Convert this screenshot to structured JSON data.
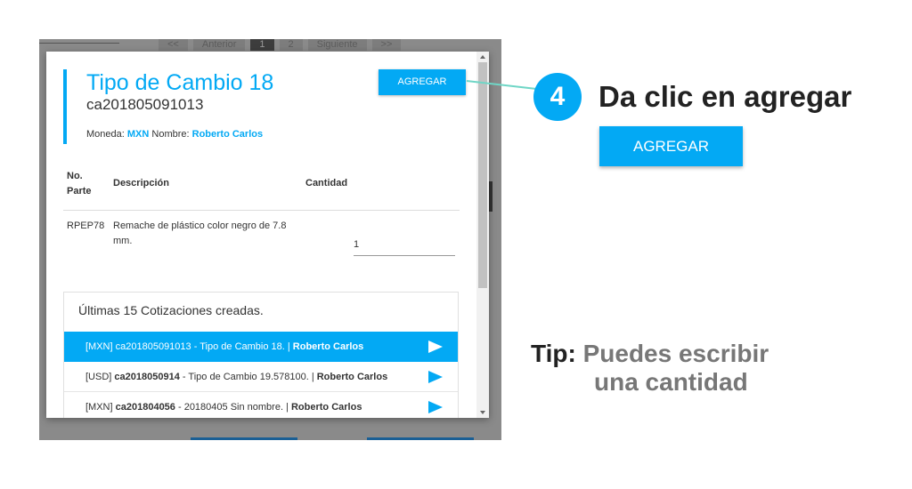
{
  "background": {
    "pager": [
      "<<",
      "Anterior",
      "1",
      "2",
      "Siguiente",
      ">>"
    ],
    "pager_active": "1"
  },
  "modal": {
    "title": "Tipo de Cambio 18",
    "code": "ca201805091013",
    "moneda_label": "Moneda:",
    "moneda_value": "MXN",
    "nombre_label": "Nombre:",
    "nombre_value": "Roberto Carlos",
    "agregar_label": "AGREGAR",
    "table": {
      "headers": {
        "no_parte": "No. Parte",
        "descripcion": "Descripción",
        "cantidad": "Cantidad"
      },
      "rows": [
        {
          "no_parte": "RPEP78",
          "descripcion": "Remache de plástico color negro de 7.8 mm.",
          "cantidad": "1"
        }
      ]
    },
    "recent": {
      "title": "Últimas 15 Cotizaciones creadas.",
      "items": [
        {
          "prefix": "[MXN] ",
          "code": "ca201805091013",
          "mid": " - Tipo de Cambio 18. | ",
          "user": "Roberto Carlos",
          "active": true
        },
        {
          "prefix": "[USD] ",
          "code": "ca2018050914",
          "mid": " - Tipo de Cambio 19.578100. | ",
          "user": "Roberto Carlos",
          "active": false
        },
        {
          "prefix": "[MXN] ",
          "code": "ca201804056",
          "mid": " - 20180405 Sin nombre. | ",
          "user": "Roberto Carlos",
          "active": false
        }
      ]
    }
  },
  "annotation": {
    "step_number": "4",
    "step_text": "Da clic en agregar",
    "button_label": "AGREGAR",
    "tip_label": "Tip:",
    "tip_line1": "Puedes escribir",
    "tip_line2": "una cantidad"
  },
  "colors": {
    "accent": "#03a9f4",
    "connector": "#6fd6c6",
    "tip_text": "#777777"
  },
  "icons": [
    "send-icon",
    "scroll-up-arrow",
    "scroll-down-arrow"
  ]
}
